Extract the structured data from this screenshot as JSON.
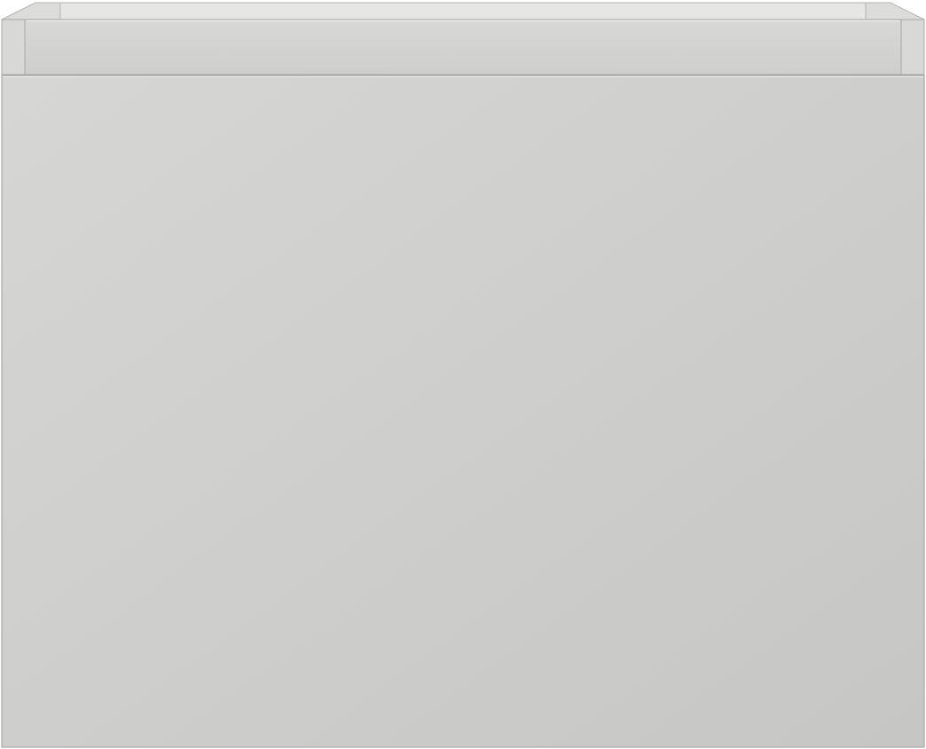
{
  "subject": {
    "icon": "drawer-cabinet-icon",
    "colors": {
      "front_light": "#d6d6d4",
      "front_dark": "#c6c6c4",
      "top_strip": "#d3d3d1",
      "inner_wall": "#e6e6e4",
      "inner_wall_shadow": "#dcdcda",
      "edge": "#a8a8a6",
      "highlight": "#f2f2f0",
      "background": "#ffffff"
    }
  }
}
